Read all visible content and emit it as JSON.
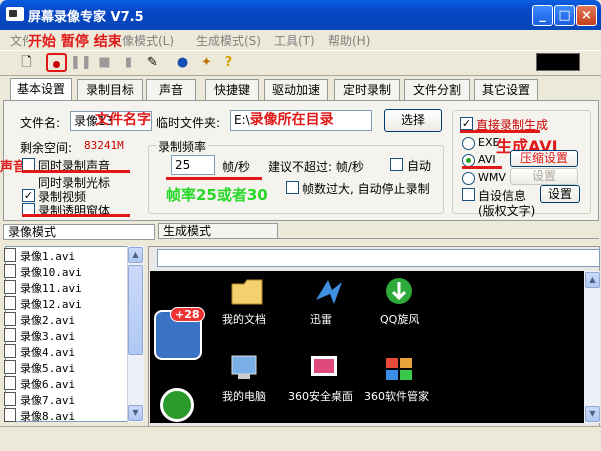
{
  "window": {
    "title": "屏幕录像专家 V7.5",
    "btn_min": "_",
    "btn_max": "□",
    "btn_close": "×"
  },
  "menu": [
    "文件",
    "录像模式(L)",
    "生成模式(S)",
    "工具(T)",
    "帮助(H)"
  ],
  "annotations": {
    "toolbar": "开始 暂停 结束",
    "filename": "文件名字",
    "folder": "录像所在目录",
    "sound": "声音",
    "fps": "帧率25或者30",
    "avi": "生成AVI"
  },
  "tabs": [
    "基本设置",
    "录制目标",
    "声音",
    "快捷键",
    "驱动加速",
    "定时录制",
    "文件分割",
    "其它设置"
  ],
  "basic": {
    "filename_label": "文件名:",
    "filename_value": "录像13",
    "tempdir_label": "临时文件夹:",
    "tempdir_value": "E:\\",
    "browse_button": "选择",
    "freespace_label": "剩余空间:",
    "freespace_value": "83241M",
    "chk_sound": "同时录制声音",
    "chk_cursor": "同时录制光标",
    "chk_video": "录制视频",
    "chk_transparent": "录制透明窗体",
    "fps_group": "录制频率",
    "fps_value": "25",
    "fps_unit": "帧/秒",
    "fps_suggest": "建议不超过: 帧/秒",
    "auto_label": "自动",
    "fps_stop": "帧数过大, 自动停止录制",
    "direct_label": "直接录制生成",
    "exe_label": "EXE",
    "avi_label": "AVI",
    "compress_button": "压缩设置",
    "wmv_label": "WMV",
    "settings_button1": "设置",
    "custom_info": "自设信息",
    "settings_button2": "设置",
    "copyright": "(版权文字)"
  },
  "lower": {
    "tab_record": "录像模式",
    "tab_generate": "生成模式",
    "files": [
      "录像1.avi",
      "录像10.avi",
      "录像11.avi",
      "录像12.avi",
      "录像2.avi",
      "录像3.avi",
      "录像4.avi",
      "录像5.avi",
      "录像6.avi",
      "录像7.avi",
      "录像8.avi"
    ]
  },
  "desktop": {
    "badge": "+28",
    "icons": [
      "我的文档",
      "迅雷",
      "QQ旋风",
      "我的电脑",
      "360安全桌面",
      "360软件管家"
    ]
  }
}
